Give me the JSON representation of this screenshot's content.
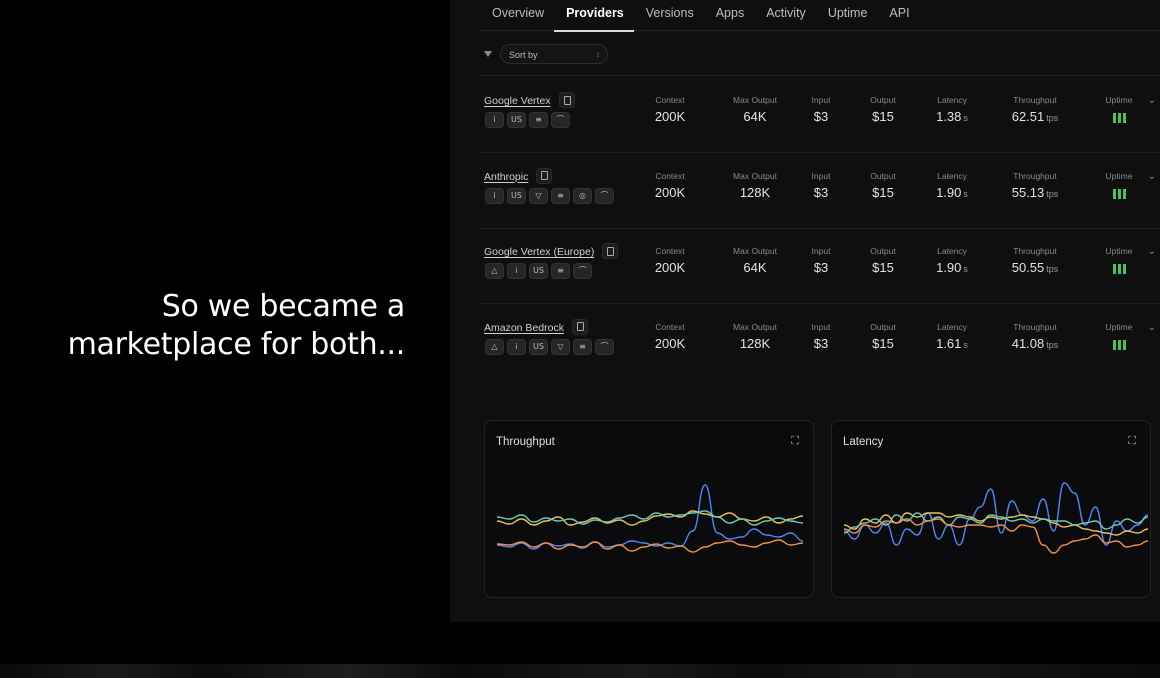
{
  "caption": {
    "line1": "So we became a",
    "line2": "marketplace for both..."
  },
  "tabs": [
    {
      "label": "Overview"
    },
    {
      "label": "Providers",
      "active": true
    },
    {
      "label": "Versions"
    },
    {
      "label": "Apps"
    },
    {
      "label": "Activity"
    },
    {
      "label": "Uptime"
    },
    {
      "label": "API"
    }
  ],
  "sort": {
    "label": "Sort by"
  },
  "columns": {
    "context": "Context",
    "max_output": "Max Output",
    "input": "Input",
    "output": "Output",
    "latency": "Latency",
    "throughput": "Throughput",
    "uptime": "Uptime"
  },
  "units": {
    "latency": "s",
    "throughput": "tps"
  },
  "providers": [
    {
      "name": "Google Vertex",
      "badges": [
        "info",
        "US",
        "doc",
        "key"
      ],
      "context": "200K",
      "max_output": "64K",
      "input": "$3",
      "output": "$15",
      "latency": "1.38",
      "throughput": "62.51"
    },
    {
      "name": "Anthropic",
      "badges": [
        "info",
        "US",
        "shield",
        "doc",
        "circle",
        "key"
      ],
      "context": "200K",
      "max_output": "128K",
      "input": "$3",
      "output": "$15",
      "latency": "1.90",
      "throughput": "55.13"
    },
    {
      "name": "Google Vertex (Europe)",
      "badges": [
        "warning",
        "info",
        "US",
        "doc",
        "key"
      ],
      "context": "200K",
      "max_output": "64K",
      "input": "$3",
      "output": "$15",
      "latency": "1.90",
      "throughput": "50.55"
    },
    {
      "name": "Amazon Bedrock",
      "badges": [
        "warning",
        "info",
        "US",
        "shield",
        "doc",
        "key"
      ],
      "context": "200K",
      "max_output": "128K",
      "input": "$3",
      "output": "$15",
      "latency": "1.61",
      "throughput": "41.08"
    }
  ],
  "charts": {
    "throughput": {
      "title": "Throughput"
    },
    "latency": {
      "title": "Latency"
    }
  },
  "colors": {
    "uptime": "#4cbf61",
    "blue": "#4f86f7",
    "orange": "#f0914a",
    "yellow": "#e9c259",
    "teal": "#6fc9b8"
  },
  "icons": {
    "filter": "filter-icon",
    "copy": "copy-icon",
    "expand": "expand-icon",
    "chevron": "chevron-down-icon"
  }
}
